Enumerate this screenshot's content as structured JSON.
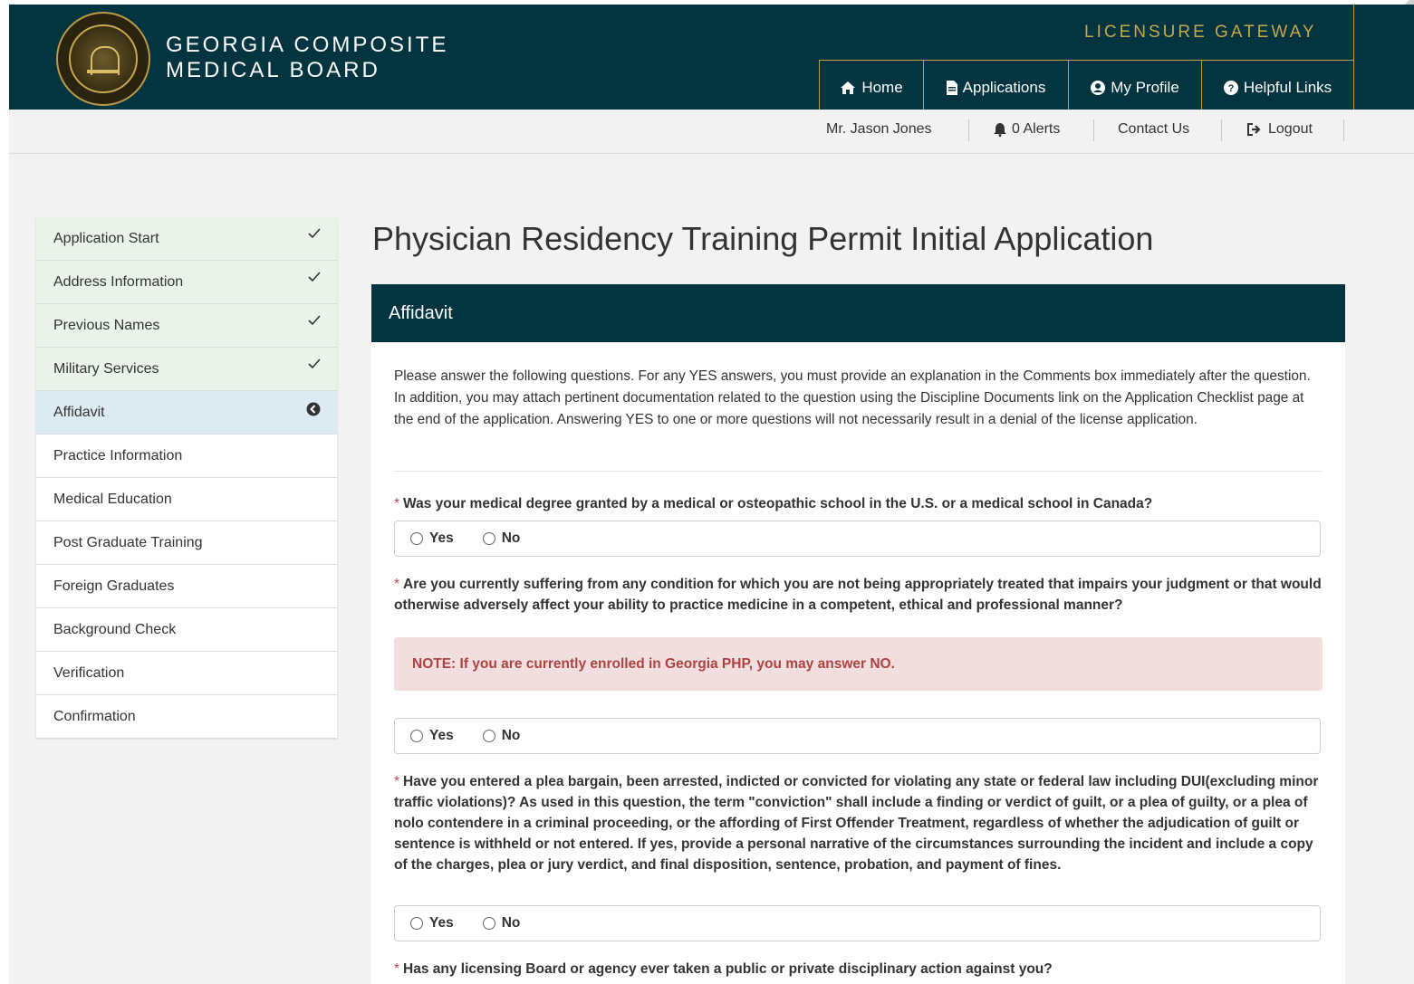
{
  "header": {
    "brand_line1": "GEORGIA COMPOSITE",
    "brand_line2": "MEDICAL BOARD",
    "gateway": "LICENSURE GATEWAY",
    "nav": [
      {
        "label": "Home",
        "icon": "home-icon"
      },
      {
        "label": "Applications",
        "icon": "document-icon"
      },
      {
        "label": "My Profile",
        "icon": "user-circle-icon"
      },
      {
        "label": "Helpful Links",
        "icon": "question-circle-icon"
      }
    ]
  },
  "subbar": {
    "user": "Mr. Jason Jones",
    "alerts": "0 Alerts",
    "contact": "Contact Us",
    "logout": "Logout"
  },
  "sidebar": {
    "items": [
      {
        "label": "Application Start",
        "state": "done"
      },
      {
        "label": "Address Information",
        "state": "done"
      },
      {
        "label": "Previous Names",
        "state": "done"
      },
      {
        "label": "Military Services",
        "state": "done"
      },
      {
        "label": "Affidavit",
        "state": "active"
      },
      {
        "label": "Practice Information",
        "state": "pending"
      },
      {
        "label": "Medical Education",
        "state": "pending"
      },
      {
        "label": "Post Graduate Training",
        "state": "pending"
      },
      {
        "label": "Foreign Graduates",
        "state": "pending"
      },
      {
        "label": "Background Check",
        "state": "pending"
      },
      {
        "label": "Verification",
        "state": "pending"
      },
      {
        "label": "Confirmation",
        "state": "pending"
      }
    ]
  },
  "main": {
    "title": "Physician Residency Training Permit Initial Application",
    "panel_title": "Affidavit",
    "intro": "Please answer the following questions. For any YES answers, you must provide an explanation in the Comments box immediately after the question. In addition, you may attach pertinent documentation related to the question using the Discipline Documents link on the Application Checklist page at the end of the application. Answering YES to one or more questions will not necessarily result in a denial of the license application.",
    "required_mark": "*",
    "yes": "Yes",
    "no": "No",
    "questions": [
      {
        "text": "Was your medical degree granted by a medical or osteopathic school in the U.S. or a medical school in Canada?"
      },
      {
        "text": "Are you currently suffering from any condition for which you are not being appropriately treated that impairs your judgment or that would otherwise adversely affect your ability to practice medicine in a competent, ethical and professional manner?",
        "note": "NOTE: If you are currently enrolled in Georgia PHP, you may answer NO."
      },
      {
        "text": "Have you entered a plea bargain, been arrested, indicted or convicted for violating any state or federal law including DUI(excluding minor traffic violations)? As used in this question, the term \"conviction\" shall include a finding or verdict of guilt, or a plea of guilty, or a plea of nolo contendere in a criminal proceeding, or the affording of First Offender Treatment, regardless of whether the adjudication of guilt or sentence is withheld or not entered. If yes, provide a personal narrative of the circumstances surrounding the incident and include a copy of the charges, plea or jury verdict, and final disposition, sentence, probation, and payment of fines."
      },
      {
        "text": "Has any licensing Board or agency ever taken a public or private disciplinary action against you?"
      }
    ]
  },
  "colors": {
    "header_bg": "#033540",
    "gold": "#c9a64a",
    "done_bg": "#eaf3ea",
    "active_bg": "#dcebf2",
    "note_bg": "#f2dede",
    "note_text": "#a94442"
  }
}
